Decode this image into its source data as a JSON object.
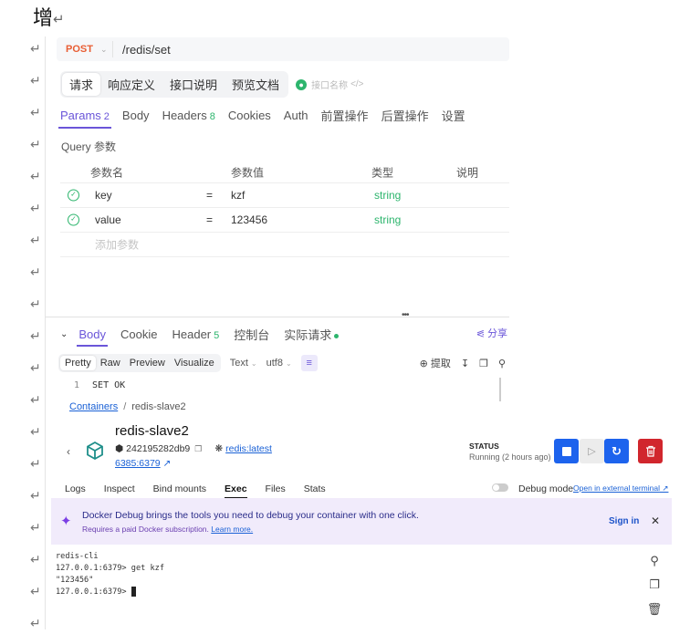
{
  "doc": {
    "title_char": "增",
    "return_mark": "↵"
  },
  "api": {
    "method": "POST",
    "url": "/redis/set",
    "main_tabs": [
      "请求",
      "响应定义",
      "接口说明",
      "预览文档"
    ],
    "name_placeholder": "接口名称",
    "sub_tabs": [
      {
        "label": "Params",
        "badge": "2"
      },
      {
        "label": "Body",
        "badge": ""
      },
      {
        "label": "Headers",
        "badge": "8"
      },
      {
        "label": "Cookies",
        "badge": ""
      },
      {
        "label": "Auth",
        "badge": ""
      },
      {
        "label": "前置操作",
        "badge": ""
      },
      {
        "label": "后置操作",
        "badge": ""
      },
      {
        "label": "设置",
        "badge": ""
      }
    ],
    "query_label": "Query 参数",
    "columns": [
      "参数名",
      "参数值",
      "类型",
      "说明"
    ],
    "params": [
      {
        "name": "key",
        "eq": "=",
        "value": "kzf",
        "type": "string"
      },
      {
        "name": "value",
        "eq": "=",
        "value": "123456",
        "type": "string"
      }
    ],
    "add_param_placeholder": "添加参数",
    "resp_tabs": [
      {
        "label": "Body",
        "badge": ""
      },
      {
        "label": "Cookie",
        "badge": ""
      },
      {
        "label": "Header",
        "badge": "5"
      },
      {
        "label": "控制台",
        "badge": ""
      },
      {
        "label": "实际请求",
        "badge": ""
      }
    ],
    "share_label": "分享",
    "format_tabs": [
      "Pretty",
      "Raw",
      "Preview",
      "Visualize"
    ],
    "text_select": "Text",
    "encoding_select": "utf8",
    "extract_label": "提取",
    "response_lines": [
      {
        "num": "1",
        "text": "SET OK"
      }
    ]
  },
  "docker": {
    "breadcrumb_root": "Containers",
    "breadcrumb_sep": "/",
    "breadcrumb_current": "redis-slave2",
    "container_name": "redis-slave2",
    "container_id": "242195282db9",
    "image": "redis:latest",
    "port": "6385:6379",
    "status_label": "STATUS",
    "status_value": "Running (2 hours ago)",
    "tabs": [
      "Logs",
      "Inspect",
      "Bind mounts",
      "Exec",
      "Files",
      "Stats"
    ],
    "active_tab": "Exec",
    "debug_mode_label": "Debug mode",
    "open_external": "Open in external terminal",
    "banner_title": "Docker Debug brings the tools you need to debug your container with one click.",
    "banner_sub": "Requires a paid Docker subscription.",
    "banner_link": "Learn more.",
    "sign_in": "Sign in",
    "terminal_lines": [
      "redis-cli",
      "127.0.0.1:6379> get kzf",
      "\"123456\"",
      "127.0.0.1:6379> "
    ]
  },
  "colors": {
    "accent_purple": "#6a55d9",
    "green": "#2db56d",
    "docker_blue": "#1d63ed",
    "danger_red": "#d1262d",
    "post_orange": "#e85d33"
  }
}
